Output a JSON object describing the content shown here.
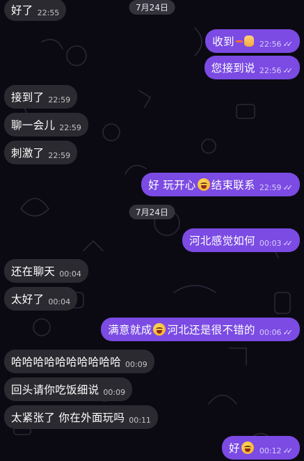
{
  "dates": {
    "first": "7月24日",
    "second": "7月24日"
  },
  "messages": [
    {
      "text": "好了",
      "time": "22:55"
    },
    {
      "text": "收到",
      "time": "22:56"
    },
    {
      "text": "您接到说",
      "time": "22:56"
    },
    {
      "text": "接到了",
      "time": "22:59"
    },
    {
      "text": "聊一会儿",
      "time": "22:59"
    },
    {
      "text": "刺激了",
      "time": "22:59"
    },
    {
      "text_a": "好 玩开心",
      "text_b": "结束联系",
      "time": "22:59"
    },
    {
      "text": "河北感觉如何",
      "time": "00:03"
    },
    {
      "text": "还在聊天",
      "time": "00:04"
    },
    {
      "text": "太好了",
      "time": "00:04"
    },
    {
      "text_a": "满意就成",
      "text_b": "河北还是很不错的",
      "time": "00:06"
    },
    {
      "text": "哈哈哈哈哈哈哈哈哈哈",
      "time": "00:09"
    },
    {
      "text": "回头请你吃饭细说",
      "time": "00:09"
    },
    {
      "text": "太紧张了 你在外面玩吗",
      "time": "00:11"
    },
    {
      "text": "好",
      "time": "00:12"
    }
  ],
  "colors": {
    "outgoing": "#7b4be3",
    "incoming": "#2a2a30",
    "background": "#0b0a12"
  },
  "icons": {
    "read_receipt": "double-check-icon",
    "emoji_face": "laughing-emoji-icon",
    "emoji_hand": "hand-emoji-icon"
  }
}
